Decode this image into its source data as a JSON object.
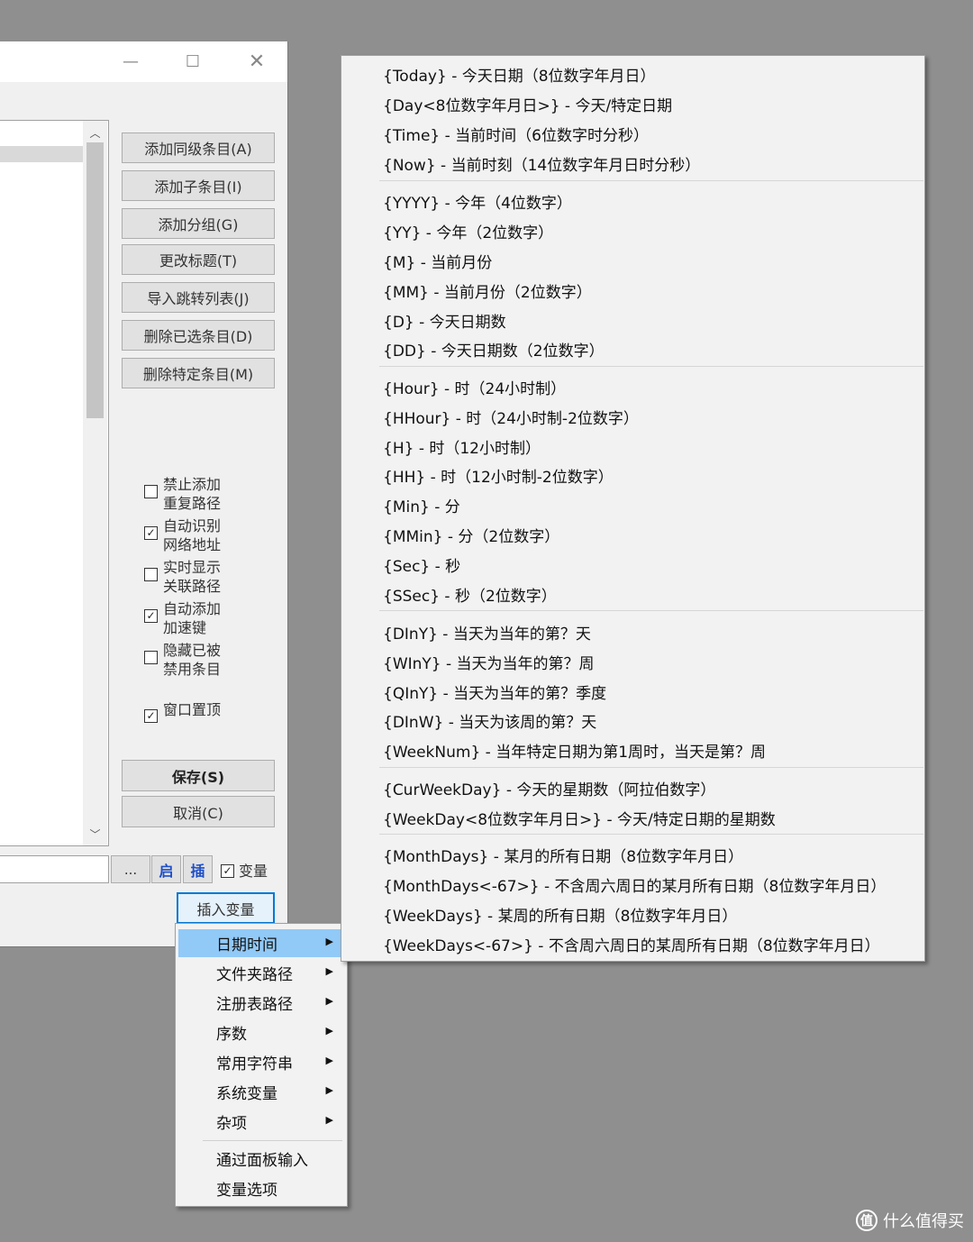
{
  "dialog": {
    "buttons": {
      "add_sibling": "添加同级条目(A)",
      "add_child": "添加子条目(I)",
      "add_group": "添加分组(G)",
      "rename": "更改标题(T)",
      "import_jump": "导入跳转列表(J)",
      "delete_selected": "删除已选条目(D)",
      "delete_specific": "删除特定条目(M)",
      "save": "保存(S)",
      "cancel": "取消(C)"
    },
    "options": [
      {
        "label": "禁止添加重复路径",
        "checked": false
      },
      {
        "label": "自动识别网络地址",
        "checked": true
      },
      {
        "label": "实时显示关联路径",
        "checked": false
      },
      {
        "label": "自动添加加速键",
        "checked": true
      },
      {
        "label": "隐藏已被禁用条目",
        "checked": false
      },
      {
        "label": "窗口置顶",
        "checked": true
      }
    ],
    "bottom": {
      "browse": "...",
      "launch": "启",
      "insert": "插",
      "variable_label": "变量",
      "insert_variable": "插入变量"
    }
  },
  "context_menu": {
    "items": [
      {
        "label": "日期时间",
        "submenu": true,
        "active": true
      },
      {
        "label": "文件夹路径",
        "submenu": true
      },
      {
        "label": "注册表路径",
        "submenu": true
      },
      {
        "label": "序数",
        "submenu": true
      },
      {
        "label": "常用字符串",
        "submenu": true
      },
      {
        "label": "系统变量",
        "submenu": true
      },
      {
        "label": "杂项",
        "submenu": true
      },
      {
        "label": "通过面板输入",
        "submenu": false
      },
      {
        "label": "变量选项",
        "submenu": false
      }
    ]
  },
  "submenu": {
    "items": [
      "{Today} - 今天日期（8位数字年月日）",
      "{Day<8位数字年月日>} - 今天/特定日期",
      "{Time} - 当前时间（6位数字时分秒）",
      "{Now} - 当前时刻（14位数字年月日时分秒）",
      "{YYYY} - 今年（4位数字）",
      "{YY} - 今年（2位数字）",
      "{M} - 当前月份",
      "{MM} - 当前月份（2位数字）",
      "{D} - 今天日期数",
      "{DD} - 今天日期数（2位数字）",
      "{Hour} - 时（24小时制）",
      "{HHour} - 时（24小时制-2位数字）",
      "{H} - 时（12小时制）",
      "{HH} - 时（12小时制-2位数字）",
      "{Min} - 分",
      "{MMin} - 分（2位数字）",
      "{Sec} - 秒",
      "{SSec} - 秒（2位数字）",
      "{DInY} - 当天为当年的第？天",
      "{WInY} - 当天为当年的第？周",
      "{QInY} - 当天为当年的第？季度",
      "{DInW} - 当天为该周的第？天",
      "{WeekNum} - 当年特定日期为第1周时，当天是第？周",
      "{CurWeekDay} - 今天的星期数（阿拉伯数字）",
      "{WeekDay<8位数字年月日>} - 今天/特定日期的星期数",
      "{MonthDays} - 某月的所有日期（8位数字年月日）",
      "{MonthDays<-67>} - 不含周六周日的某月所有日期（8位数字年月日）",
      "{WeekDays} - 某周的所有日期（8位数字年月日）",
      "{WeekDays<-67>} - 不含周六周日的某周所有日期（8位数字年月日）"
    ]
  },
  "watermark": {
    "icon_text": "值",
    "text": "什么值得买"
  },
  "icons": {
    "minimize": "minimize-icon",
    "maximize": "maximize-icon",
    "close": "close-icon",
    "submenu_arrow": "triangle-right-icon",
    "check": "checkmark-icon"
  },
  "colors": {
    "background": "#8f8f8f",
    "menu_highlight": "#91c9f7",
    "focus_border": "#0078d7",
    "link_blue": "#1e4fc8"
  }
}
